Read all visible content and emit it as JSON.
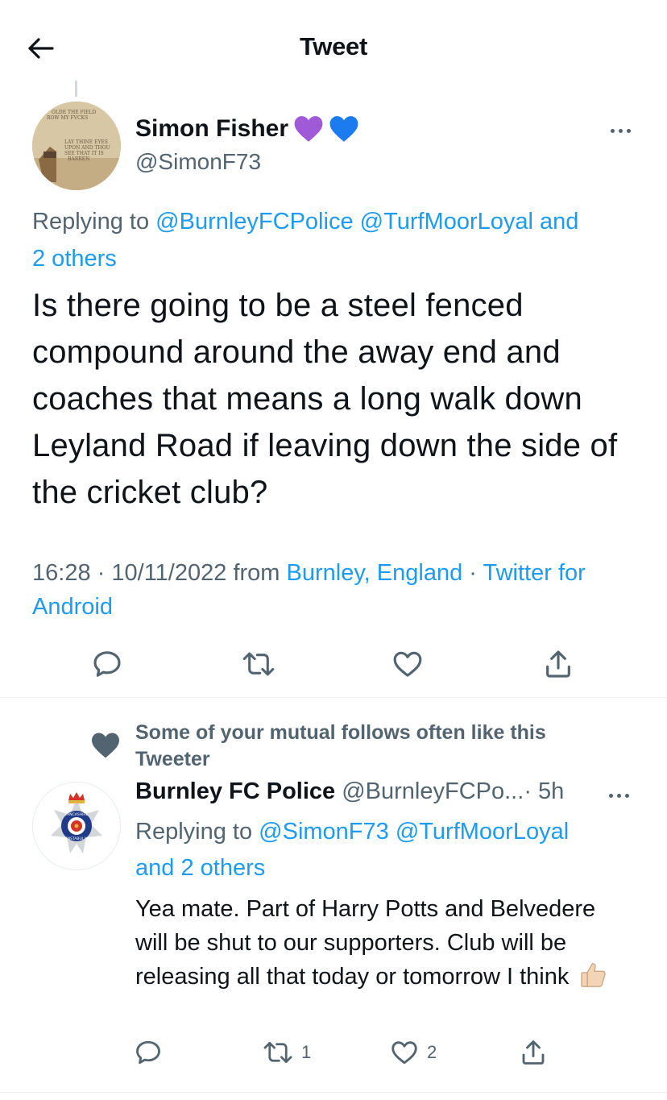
{
  "header": {
    "title": "Tweet"
  },
  "main_tweet": {
    "name": "Simon Fisher",
    "name_emojis": [
      "purple-heart",
      "blue-heart"
    ],
    "handle": "@SimonF73",
    "avatar_text": [
      "OLDE THE FIELD",
      "ROW MY FVCKS",
      "LAY THINE EYES",
      "UPON AND THOU",
      "SEE THAT IT IS",
      "BARREN"
    ],
    "replying_prefix": "Replying to",
    "replying_users": [
      "@BurnleyFCPolice",
      "@TurfMoorLoyal"
    ],
    "replying_and": "and",
    "replying_others": "2 others",
    "text": "Is there going to be a steel fenced compound around the away end and coaches that means a long walk down Leyland Road if leaving down the side of the cricket club?",
    "time": "16:28",
    "date": "10/11/2022",
    "from": "from",
    "location": "Burnley, England",
    "source": "Twitter for Android",
    "separator": "·"
  },
  "reply_tweet": {
    "social_context": "Some of your mutual follows often like this Tweeter",
    "name": "Burnley FC Police",
    "handle": "@BurnleyFCPo...",
    "separator": "·",
    "time": "5h",
    "avatar_text": [
      "LANCASHIRE",
      "CONSTABULARY"
    ],
    "replying_prefix": "Replying to",
    "replying_users": [
      "@SimonF73",
      "@TurfMoorLoyal"
    ],
    "replying_and": "and",
    "replying_others": "2 others",
    "text": "Yea mate. Part of Harry Potts and Belvedere will be shut to our supporters. Club will be releasing all that today or tomorrow I think",
    "text_emoji": "thumbs-up",
    "retweet_count": "1",
    "like_count": "2"
  },
  "colors": {
    "link": "#1d9bf0",
    "muted": "#536471",
    "text": "#0f1419",
    "divider": "#eff3f4",
    "purple_heart": "#a05ad8",
    "blue_heart": "#1d7bf0"
  }
}
